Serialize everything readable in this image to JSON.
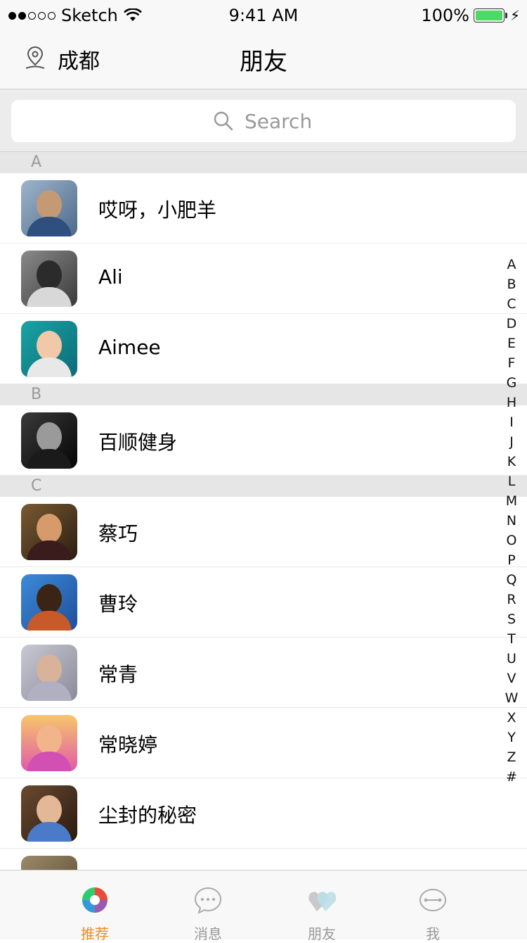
{
  "status_bar": {
    "carrier": "Sketch",
    "time": "9:41 AM",
    "battery": "100%"
  },
  "nav": {
    "city": "成都",
    "title": "朋友"
  },
  "search": {
    "placeholder": "Search"
  },
  "sections": [
    {
      "letter": "A",
      "contacts": [
        {
          "name": "哎呀，小肥羊"
        },
        {
          "name": "Ali"
        },
        {
          "name": "Aimee"
        }
      ]
    },
    {
      "letter": "B",
      "contacts": [
        {
          "name": "百顺健身"
        }
      ]
    },
    {
      "letter": "C",
      "contacts": [
        {
          "name": "蔡巧"
        },
        {
          "name": "曹玲"
        },
        {
          "name": "常青"
        },
        {
          "name": "常晓婷"
        },
        {
          "name": "尘封的秘密"
        }
      ]
    }
  ],
  "index_letters": [
    "A",
    "B",
    "C",
    "D",
    "E",
    "F",
    "G",
    "H",
    "I",
    "J",
    "K",
    "L",
    "M",
    "N",
    "O",
    "P",
    "Q",
    "R",
    "S",
    "T",
    "U",
    "V",
    "W",
    "X",
    "Y",
    "Z",
    "#"
  ],
  "tabs": [
    {
      "label": "推荐",
      "icon": "recommend-icon"
    },
    {
      "label": "消息",
      "icon": "message-icon"
    },
    {
      "label": "朋友",
      "icon": "friends-icon"
    },
    {
      "label": "我",
      "icon": "me-icon"
    }
  ],
  "colors": {
    "accent": "#f08a24",
    "battery": "#4cd964"
  }
}
